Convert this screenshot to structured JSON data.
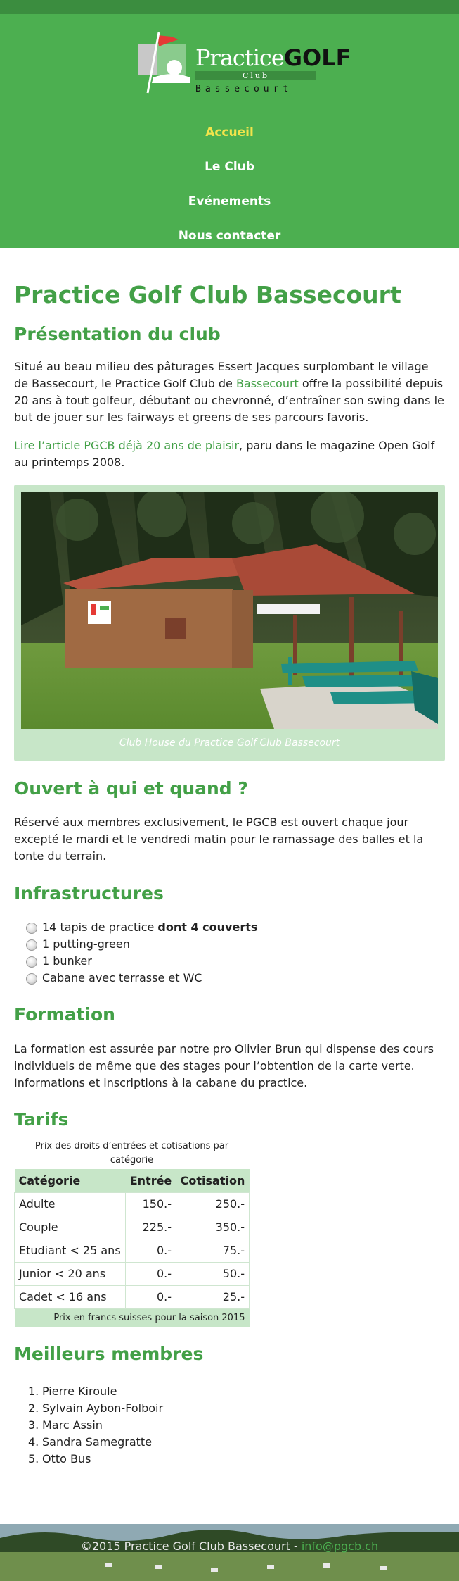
{
  "brand": {
    "wordmark_light": "Practice",
    "wordmark_bold": "GOLF",
    "club": "Club",
    "city": "Bassecourt"
  },
  "nav": {
    "items": [
      "Accueil",
      "Le Club",
      "Evénements",
      "Nous contacter"
    ],
    "active": "Accueil",
    "active_color": "#f2e44b"
  },
  "colors": {
    "header_green": "#4caf50",
    "heading_green": "#43a047",
    "table_green": "#c7e6c8"
  },
  "page": {
    "title": "Practice Golf Club Bassecourt",
    "presentation": {
      "heading": "Présentation du club",
      "p1_before": "Situé au beau milieu des pâturages Essert Jacques surplombant le village de Bassecourt, le Practice Golf Club de ",
      "p1_link": "Bassecourt",
      "p1_after": " offre la possibilité depuis 20 ans à tout golfeur, débutant ou chevronné, d’entraîner son swing dans le but de jouer sur les fairways et greens de ses parcours favoris.",
      "p2_link": "Lire l’article PGCB déjà 20 ans de plaisir",
      "p2_after": ", paru dans le magazine Open Golf au printemps 2008.",
      "caption": "Club House du Practice Golf Club Bassecourt"
    },
    "hours": {
      "heading": "Ouvert à qui et quand ?",
      "text": "Réservé aux membres exclusivement, le PGCB est ouvert chaque jour excepté le mardi et le vendredi matin pour le ramassage des balles et la tonte du terrain."
    },
    "infra": {
      "heading": "Infrastructures",
      "item1": "14 tapis de practice ",
      "item1_bold": "dont 4 couverts",
      "item2": "1 putting-green",
      "item3": "1 bunker",
      "item4": "Cabane avec terrasse et WC"
    },
    "formation": {
      "heading": "Formation",
      "text": "La formation est assurée par notre pro Olivier Brun qui dispense des cours individuels de même que des stages pour l’obtention de la carte verte. Informations et inscriptions à la cabane du practice."
    },
    "tarifs": {
      "heading": "Tarifs",
      "caption": "Prix des droits d’entrées et cotisations par catégorie",
      "headers": [
        "Catégorie",
        "Entrée",
        "Cotisation"
      ],
      "rows": [
        [
          "Adulte",
          "150.-",
          "250.-"
        ],
        [
          "Couple",
          "225.-",
          "350.-"
        ],
        [
          "Etudiant < 25 ans",
          "0.-",
          "75.-"
        ],
        [
          "Junior < 20 ans",
          "0.-",
          "50.-"
        ],
        [
          "Cadet < 16 ans",
          "0.-",
          "25.-"
        ]
      ],
      "footnote": "Prix en francs suisses pour la saison 2015"
    },
    "members": {
      "heading": "Meilleurs membres",
      "list": [
        "Pierre Kiroule",
        "Sylvain Aybon-Folboir",
        "Marc Assin",
        "Sandra Samegratte",
        "Otto Bus"
      ]
    }
  },
  "footer": {
    "text": "©2015 Practice Golf Club Bassecourt - ",
    "email": "info@pgcb.ch"
  }
}
